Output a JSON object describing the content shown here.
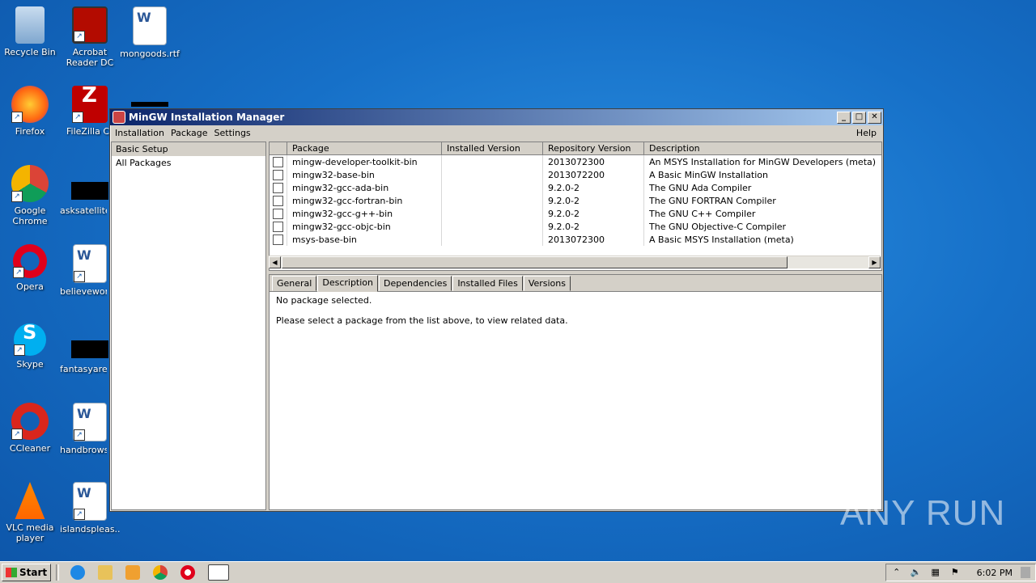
{
  "desktop": {
    "icons": [
      {
        "label": "Recycle Bin"
      },
      {
        "label": "Acrobat Reader DC"
      },
      {
        "label": "mongoods.rtf"
      },
      {
        "label": "Firefox"
      },
      {
        "label": "FileZilla Client"
      },
      {
        "label": "Google Chrome"
      },
      {
        "label": "asksatellite"
      },
      {
        "label": "Opera"
      },
      {
        "label": "believework"
      },
      {
        "label": "Skype"
      },
      {
        "label": "fantasyare"
      },
      {
        "label": "CCleaner"
      },
      {
        "label": "handbrowse"
      },
      {
        "label": "VLC media player"
      },
      {
        "label": "islandspleas..."
      }
    ]
  },
  "window": {
    "title": "MinGW Installation Manager",
    "menu": [
      "Installation",
      "Package",
      "Settings"
    ],
    "help": "Help",
    "left_items": [
      "Basic Setup",
      "All Packages"
    ],
    "columns": [
      "Package",
      "Installed Version",
      "Repository Version",
      "Description"
    ],
    "packages": [
      {
        "name": "mingw-developer-toolkit-bin",
        "installed": "",
        "repo": "2013072300",
        "desc": "An MSYS Installation for MinGW Developers (meta)"
      },
      {
        "name": "mingw32-base-bin",
        "installed": "",
        "repo": "2013072200",
        "desc": "A Basic MinGW Installation"
      },
      {
        "name": "mingw32-gcc-ada-bin",
        "installed": "",
        "repo": "9.2.0-2",
        "desc": "The GNU Ada Compiler"
      },
      {
        "name": "mingw32-gcc-fortran-bin",
        "installed": "",
        "repo": "9.2.0-2",
        "desc": "The GNU FORTRAN Compiler"
      },
      {
        "name": "mingw32-gcc-g++-bin",
        "installed": "",
        "repo": "9.2.0-2",
        "desc": "The GNU C++ Compiler"
      },
      {
        "name": "mingw32-gcc-objc-bin",
        "installed": "",
        "repo": "9.2.0-2",
        "desc": "The GNU Objective-C Compiler"
      },
      {
        "name": "msys-base-bin",
        "installed": "",
        "repo": "2013072300",
        "desc": "A Basic MSYS Installation (meta)"
      }
    ],
    "tabs": [
      "General",
      "Description",
      "Dependencies",
      "Installed Files",
      "Versions"
    ],
    "detail_line1": "No package selected.",
    "detail_line2": "Please select a package from the list above, to view related data."
  },
  "taskbar": {
    "start": "Start",
    "clock": "6:02 PM"
  },
  "watermark": "ANY RUN"
}
